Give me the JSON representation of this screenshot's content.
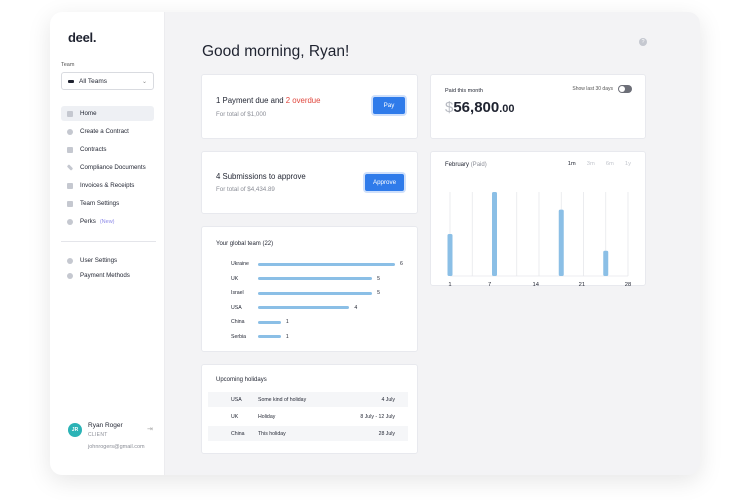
{
  "sidebar": {
    "logo": "deel.",
    "team_label": "Team",
    "team_select": "All Teams",
    "nav": [
      {
        "label": "Home",
        "icon": "home-icon",
        "active": true
      },
      {
        "label": "Create a Contract",
        "icon": "plus-circle-icon"
      },
      {
        "label": "Contracts",
        "icon": "document-icon"
      },
      {
        "label": "Compliance Documents",
        "icon": "link-icon"
      },
      {
        "label": "Invoices & Receipts",
        "icon": "receipt-icon"
      },
      {
        "label": "Team Settings",
        "icon": "settings-icon"
      },
      {
        "label": "Perks",
        "icon": "star-icon",
        "tag": "(New)"
      }
    ],
    "nav_secondary": [
      {
        "label": "User Settings",
        "icon": "user-icon"
      },
      {
        "label": "Payment Methods",
        "icon": "card-icon"
      }
    ],
    "user": {
      "initials": "JR",
      "name": "Ryan Roger",
      "role": "CLIENT",
      "email": "johnrogers@gmail.com"
    }
  },
  "main": {
    "greeting": "Good morning, Ryan!",
    "payment_card": {
      "title_prefix": "1 Payment due and ",
      "title_overdue": "2 overdue",
      "subtitle": "For total of $1,000",
      "button": "Pay"
    },
    "submissions_card": {
      "title": "4 Submissions to approve",
      "subtitle": "For total of $4,434.89",
      "button": "Approve"
    },
    "paid_card": {
      "label": "Paid this month",
      "currency": "$",
      "amount": "56,800",
      "cents": ".00",
      "toggle_label": "Show last 30 days",
      "toggle_on": false
    },
    "chart_card": {
      "title": "February",
      "title_suffix": "(Paid)",
      "ranges": [
        "1m",
        "3m",
        "6m",
        "1y"
      ],
      "active_range": "1m"
    },
    "team_card": {
      "title": "Your global team (22)",
      "countries": [
        {
          "name": "Ukraine",
          "count": 6
        },
        {
          "name": "UK",
          "count": 5
        },
        {
          "name": "Israel",
          "count": 5
        },
        {
          "name": "USA",
          "count": 4
        },
        {
          "name": "China",
          "count": 1
        },
        {
          "name": "Serbia",
          "count": 1
        }
      ]
    },
    "holidays_card": {
      "title": "Upcoming holidays",
      "rows": [
        {
          "country": "USA",
          "name": "Some kind of holiday",
          "date": "4 July"
        },
        {
          "country": "UK",
          "name": "Holiday",
          "date": "8 July - 12 July"
        },
        {
          "country": "China",
          "name": "This holiday",
          "date": "28 July"
        }
      ]
    }
  },
  "chart_data": {
    "type": "bar",
    "title": "February (Paid)",
    "x_ticks": [
      "1",
      "7",
      "14",
      "21",
      "28"
    ],
    "bars": [
      {
        "x": 1,
        "value": 0.5
      },
      {
        "x": 7,
        "value": 1.0
      },
      {
        "x": 14,
        "value": 0.0
      },
      {
        "x": 21,
        "value": 0.79
      },
      {
        "x": 28,
        "value": 0.3
      }
    ],
    "gridlines": 9,
    "grid": true,
    "note": "Bar heights are relative; y-axis has no printed values"
  },
  "colors": {
    "accent": "#2f7bea",
    "overdue": "#e0463c",
    "bar": "#8bbfe6",
    "avatar": "#2bb3b6",
    "perks_tag": "#8d8ae8"
  }
}
